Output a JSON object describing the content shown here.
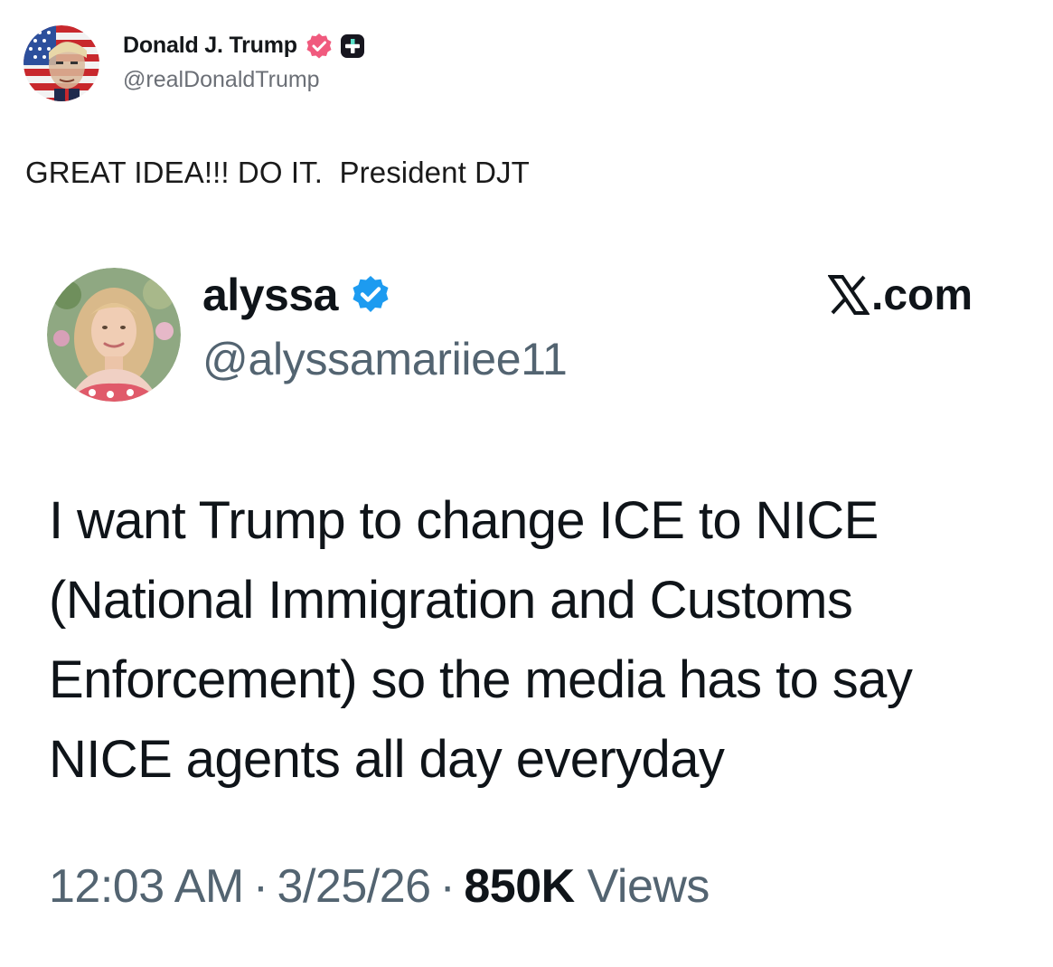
{
  "post": {
    "author": {
      "display_name": "Donald J. Trump",
      "handle": "@realDonaldTrump",
      "verified_badge_color": "#f05a7e",
      "avatar_icon": "flag-portrait-avatar"
    },
    "text": "GREAT IDEA!!! DO IT.  President DJT"
  },
  "embedded_tweet": {
    "author": {
      "display_name": "alyssa",
      "handle": "@alyssamariiee11",
      "verified_badge_color": "#1d9bf0",
      "avatar_icon": "portrait-avatar"
    },
    "brand": {
      "logo_icon": "x-logo-icon",
      "domain": ".com"
    },
    "body_lines": [
      "I want Trump to change ICE to NICE",
      "(National Immigration and Customs",
      "Enforcement) so the media has to say",
      "NICE agents all day everyday"
    ],
    "meta": {
      "time": "12:03 AM",
      "separator": "·",
      "date": "3/25/26",
      "views_count": "850K",
      "views_label": "Views"
    }
  }
}
